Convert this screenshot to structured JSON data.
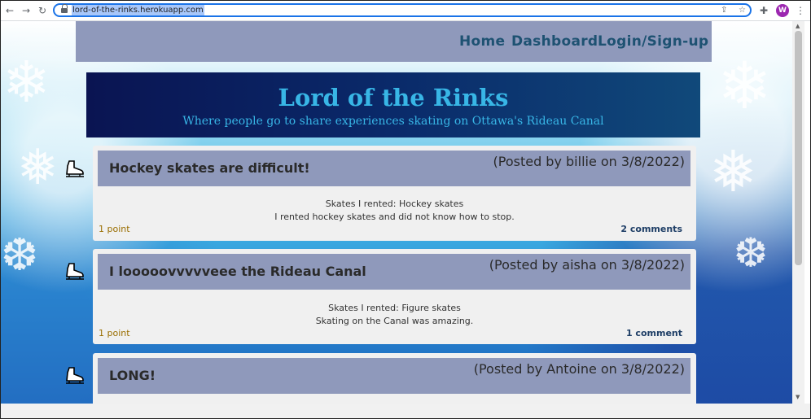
{
  "browser": {
    "url": "lord-of-the-rinks.herokuapp.com",
    "back_icon": "←",
    "forward_icon": "→",
    "reload_icon": "↻",
    "share_icon": "⇪",
    "star_icon": "☆",
    "extensions_icon": "✚",
    "avatar_letter": "W",
    "menu_icon": "⋮"
  },
  "navbar": {
    "home": "Home",
    "dashboard": "Dashboard",
    "login": "Login/Sign-up"
  },
  "hero": {
    "title": "Lord of the Rinks",
    "subtitle": "Where people go to share experiences skating on Ottawa's Rideau Canal"
  },
  "posts": [
    {
      "title": "Hockey skates are difficult!",
      "meta": "(Posted by billie on 3/8/2022)",
      "skates": "Skates I rented: Hockey skates",
      "content": "I rented hockey skates and did not know how to stop.",
      "points": "1 point",
      "comments": "2 comments"
    },
    {
      "title": "I looooovvvvveee the Rideau Canal",
      "meta": "(Posted by aisha on 3/8/2022)",
      "skates": "Skates I rented: Figure skates",
      "content": "Skating on the Canal was amazing.",
      "points": "1 point",
      "comments": "1 comment"
    },
    {
      "title": "LONG!",
      "meta": "(Posted by Antoine on 3/8/2022)"
    }
  ],
  "colors": {
    "navbar_bg": "#8f99bb",
    "link": "#1e5272",
    "hero_title": "#38b6e6",
    "points": "#9a6e00"
  }
}
